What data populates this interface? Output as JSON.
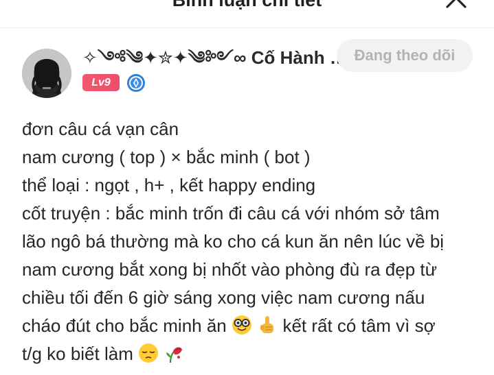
{
  "header": {
    "title": "Bình luận chi tiết",
    "close_icon": "close-icon"
  },
  "user": {
    "avatar_icon": "avatar",
    "name": "✧༺༄✦✮✦༄༻∞ Cố Hành Ngu...",
    "level": "Lv9",
    "badge_icon": "verified-badge-icon",
    "follow_label": "Đang theo dõi"
  },
  "comment": {
    "lines": [
      "đơn câu cá vạn cân",
      "nam cương ( top ) × bắc minh ( bot )",
      "thể loại : ngọt , h+ , kết happy ending",
      "cốt truyện : bắc minh trốn đi câu cá với nhóm sở tâm",
      "lão ngô bá thường mà ko cho cá kun ăn nên lúc về bị",
      "nam cương bắt xong bị nhốt vào phòng đù ra đẹp từ",
      "chiều tối đến 6 giờ sáng xong việc nam cương nấu",
      "cháo đút cho bắc minh ăn ",
      " kết rất có tâm vì sợ",
      "t/g ko biết làm "
    ],
    "emoji_icons": [
      "nerd-face-emoji",
      "pointing-up-emoji",
      "pensive-face-emoji",
      "wilted-flower-emoji"
    ]
  }
}
